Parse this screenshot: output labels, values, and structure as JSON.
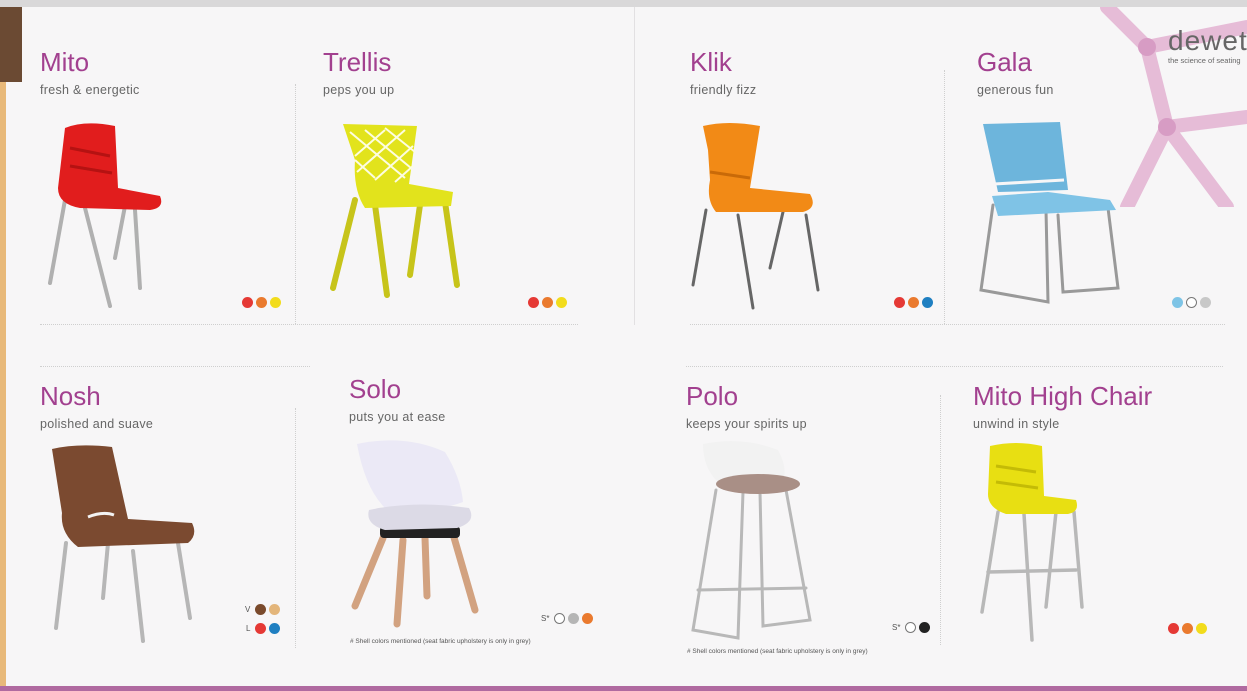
{
  "brand": {
    "logo": "dewet",
    "tagline": "the science of seating"
  },
  "chairs": [
    {
      "name": "Mito",
      "tagline": "fresh & energetic",
      "colors": [
        "#e53935",
        "#ea7a2e",
        "#f2dc1c"
      ]
    },
    {
      "name": "Trellis",
      "tagline": "peps you up",
      "colors": [
        "#e53935",
        "#ea7a2e",
        "#f2dc1c"
      ]
    },
    {
      "name": "Klik",
      "tagline": "friendly fizz",
      "colors": [
        "#e53935",
        "#ea7a2e",
        "#1f7fc1"
      ]
    },
    {
      "name": "Gala",
      "tagline": "generous fun",
      "colors": [
        "#7ec4e6",
        "#ffffff",
        "#c8c8c8"
      ]
    },
    {
      "name": "Nosh",
      "tagline": "polished and suave",
      "variant_v": {
        "label": "V",
        "colors": [
          "#7a4a2c",
          "#e3b57a"
        ]
      },
      "variant_l": {
        "label": "L",
        "colors": [
          "#e53935",
          "#1f7fc1"
        ]
      }
    },
    {
      "name": "Solo",
      "tagline": "puts you at ease",
      "marker": "S*",
      "colors": [
        "#ffffff",
        "#b5b5b5",
        "#ea7a2e"
      ],
      "note": "# Shell colors mentioned (seat fabric upholstery is only in grey)"
    },
    {
      "name": "Polo",
      "tagline": "keeps your spirits up",
      "marker": "S*",
      "colors": [
        "#ffffff",
        "#222222"
      ],
      "note": "# Shell colors mentioned (seat fabric upholstery is only in grey)"
    },
    {
      "name": "Mito High Chair",
      "tagline": "unwind in style",
      "colors": [
        "#e53935",
        "#ea7a2e",
        "#f2dc1c"
      ]
    }
  ]
}
